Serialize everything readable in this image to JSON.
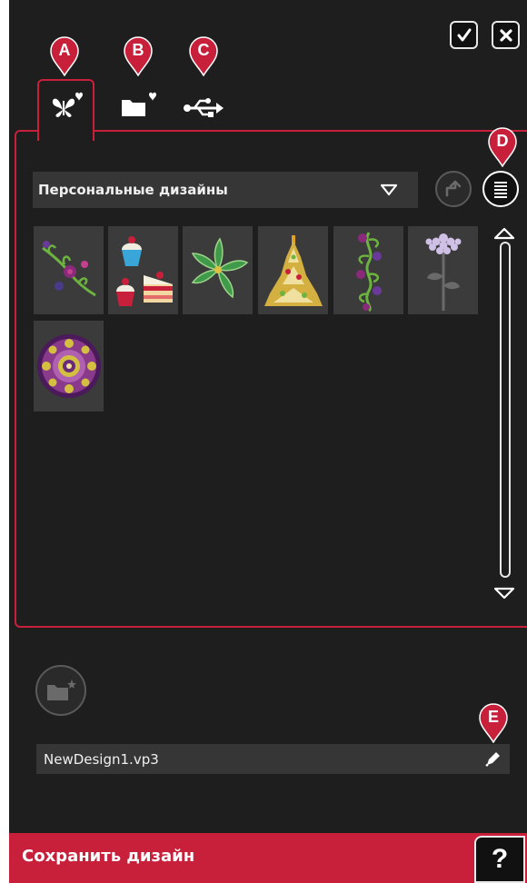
{
  "header": {
    "confirm_icon": "checkmark-icon",
    "close_icon": "close-icon"
  },
  "tabs": [
    {
      "icon": "personal-designs-icon",
      "marker": "A",
      "active": true
    },
    {
      "icon": "personal-files-icon",
      "marker": "B",
      "active": false
    },
    {
      "icon": "usb-icon",
      "marker": "C",
      "active": false
    }
  ],
  "browser": {
    "folder_label": "Персональные дизайны",
    "back_icon": "folder-up-icon",
    "view_toggle_icon": "list-view-icon",
    "view_toggle_marker": "D",
    "designs": [
      {
        "icon": "floral-vine-design-icon"
      },
      {
        "icon": "cupcakes-design-icon"
      },
      {
        "icon": "green-flower-design-icon"
      },
      {
        "icon": "ornamental-tree-design-icon"
      },
      {
        "icon": "flower-border-design-icon"
      },
      {
        "icon": "lilac-flower-design-icon"
      },
      {
        "icon": "mandala-design-icon"
      }
    ]
  },
  "new_folder_icon": "new-folder-icon",
  "filename": {
    "value": "NewDesign1.vp3",
    "edit_icon": "pencil-icon",
    "marker": "E"
  },
  "footer": {
    "title": "Сохранить дизайн",
    "help_label": "?"
  },
  "colors": {
    "accent": "#c8203b",
    "background": "#1e1e1e",
    "field": "#363636"
  }
}
